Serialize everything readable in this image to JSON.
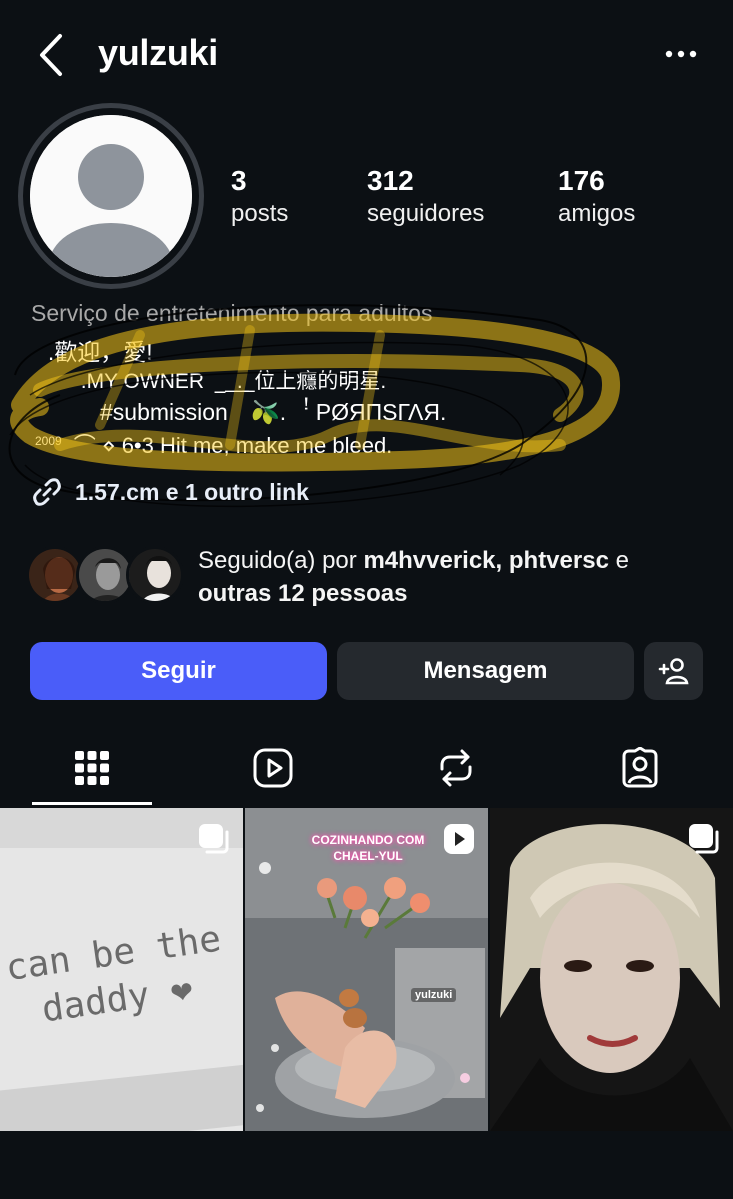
{
  "header": {
    "username": "yulzuki"
  },
  "stats": [
    {
      "value": "3",
      "label": "posts"
    },
    {
      "value": "312",
      "label": "seguidores"
    },
    {
      "value": "176",
      "label": "amigos"
    }
  ],
  "bio": {
    "category": "Serviço de entretenimento para adultos",
    "line2": "⠀.歡迎，愛!",
    "line3": "⠀⠀.MY OWNER ⠀̲ ̲ .̲ ̲ 位上癮的明星.",
    "line4": "#submission ⠀🫒.⠀ꜝ PØЯПSΓΛЯ.",
    "line5_small": "2009",
    "line5": "⌒ ⋄ 6•3 Hit me, make me bleed.",
    "link": "1.57.cm e 1 outro link"
  },
  "followed_by": {
    "prefix": "Seguido(a) por",
    "users": "m4hvverick, phtversc",
    "conj": "e",
    "others": "outras 12 pessoas"
  },
  "buttons": {
    "follow": "Seguir",
    "message": "Mensagem"
  },
  "posts": [
    {
      "text_line1": "can be the b",
      "text_line2": "daddy ❤",
      "type": "carousel"
    },
    {
      "title_line1": "COZINHANDO COM",
      "title_line2": "CHAEL-YUL",
      "watermark": "yulzuki",
      "type": "reel"
    },
    {
      "type": "carousel"
    }
  ],
  "colors": {
    "background": "#0c1014",
    "follow_button": "#4a5df9",
    "secondary_button": "#25292e",
    "scribble": "#f5c518"
  }
}
